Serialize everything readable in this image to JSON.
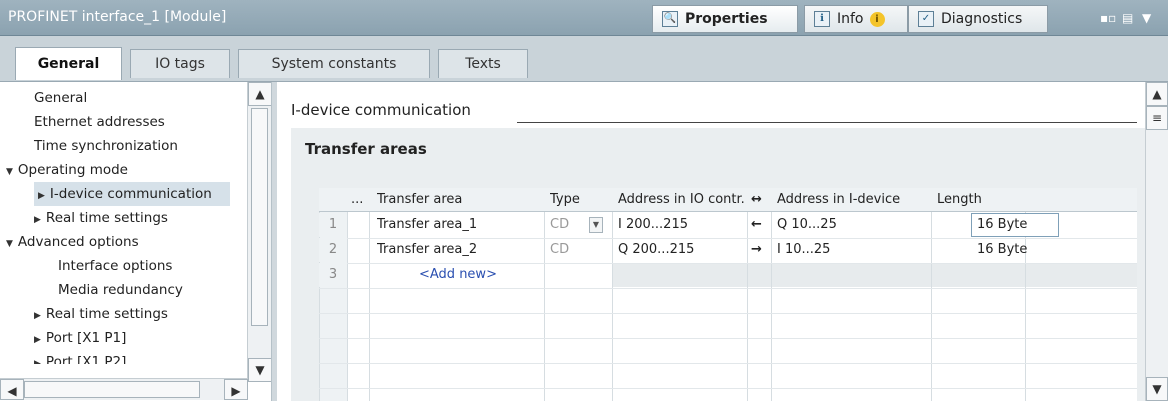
{
  "titlebar": {
    "title": "PROFINET interface_1 [Module]",
    "properties_label": "Properties",
    "info_label": "Info",
    "info_badge": "i",
    "diagnostics_label": "Diagnostics"
  },
  "tabs": [
    {
      "label": "General",
      "active": true
    },
    {
      "label": "IO tags",
      "active": false
    },
    {
      "label": "System constants",
      "active": false
    },
    {
      "label": "Texts",
      "active": false
    }
  ],
  "tree": [
    {
      "label": "General",
      "expander": ""
    },
    {
      "label": "Ethernet addresses",
      "expander": ""
    },
    {
      "label": "Time synchronization",
      "expander": ""
    },
    {
      "label": "Operating mode",
      "expander": "expanded"
    },
    {
      "label": "I-device communication",
      "expander": "collapsed",
      "selected": true
    },
    {
      "label": "Real time settings",
      "expander": "collapsed"
    },
    {
      "label": "Advanced options",
      "expander": "expanded"
    },
    {
      "label": "Interface options",
      "expander": ""
    },
    {
      "label": "Media redundancy",
      "expander": ""
    },
    {
      "label": "Real time settings",
      "expander": "collapsed"
    },
    {
      "label": "Port [X1 P1]",
      "expander": "collapsed"
    },
    {
      "label": "Port [X1 P2]",
      "expander": "collapsed"
    }
  ],
  "section": {
    "heading": "I-device communication",
    "panel_title": "Transfer areas"
  },
  "table": {
    "headers": {
      "dots": "...",
      "area": "Transfer area",
      "type": "Type",
      "io": "Address in IO contr...",
      "arrow": "↔",
      "idev": "Address in I-device",
      "length": "Length"
    },
    "rows": [
      {
        "num": "1",
        "area": "Transfer area_1",
        "type": "CD",
        "io": "I 200...215",
        "arrow": "←",
        "idev": "Q 10...25",
        "length": "16 Byte"
      },
      {
        "num": "2",
        "area": "Transfer area_2",
        "type": "CD",
        "io": "Q 200...215",
        "arrow": "→",
        "idev": "I 10...25",
        "length": "16 Byte"
      },
      {
        "num": "3",
        "area": "<Add new>",
        "type": "",
        "io": "",
        "arrow": "",
        "idev": "",
        "length": ""
      }
    ]
  },
  "icons": {
    "properties": "properties-icon",
    "info": "info-icon",
    "diagnostics": "diagnostics-icon"
  }
}
